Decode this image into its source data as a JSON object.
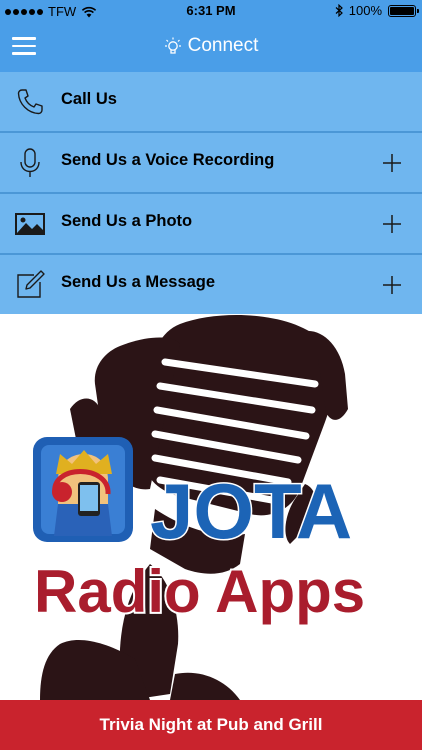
{
  "status_bar": {
    "carrier": "TFW",
    "time": "6:31 PM",
    "battery": "100%"
  },
  "navbar": {
    "title": "Connect",
    "menu_icon": "hamburger-icon",
    "title_icon": "lightbulb-icon"
  },
  "actions": [
    {
      "label": "Call Us",
      "icon": "phone-icon",
      "expandable": false
    },
    {
      "label": "Send Us a Voice Recording",
      "icon": "microphone-icon",
      "expandable": true
    },
    {
      "label": "Send Us a Photo",
      "icon": "photo-icon",
      "expandable": true
    },
    {
      "label": "Send Us a Message",
      "icon": "compose-icon",
      "expandable": true
    }
  ],
  "hero": {
    "brand": "JOTA",
    "tagline": "Radio Apps"
  },
  "footer": {
    "banner": "Trivia Night at Pub and Grill"
  },
  "colors": {
    "header_blue": "#4a9ee8",
    "row_blue": "#6fb6ef",
    "brand_blue": "#1c64b6",
    "brand_red": "#a91d2d",
    "footer_red": "#c9232d"
  }
}
